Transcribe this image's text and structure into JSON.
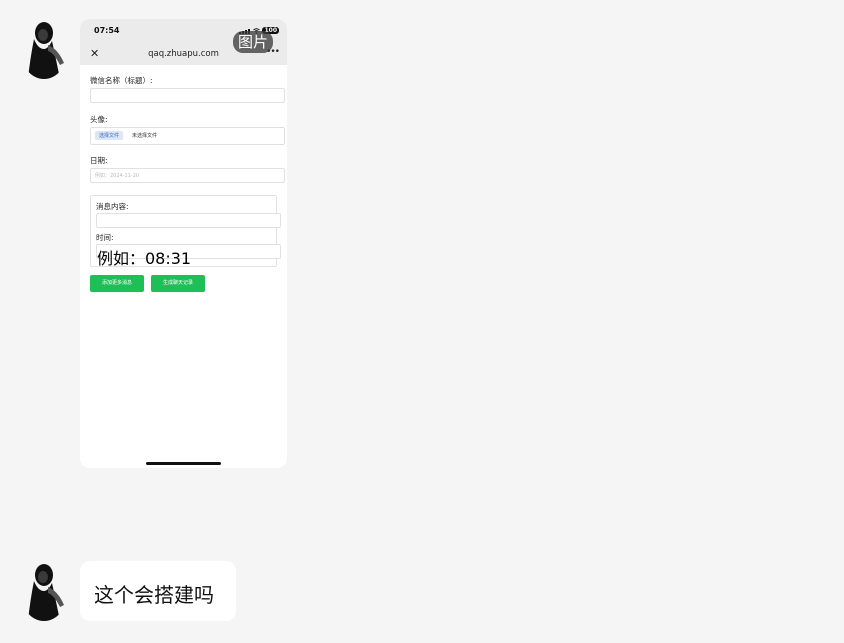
{
  "messages": [
    {
      "type": "image",
      "image_tag": "图片",
      "phone": {
        "status_time": "07:54",
        "battery": "100",
        "url": "qaq.zhuapu.com",
        "form": {
          "wechat_name_label": "微信名称（标题）:",
          "avatar_label": "头像:",
          "file_button": "选择文件",
          "file_status": "未选择文件",
          "date_label": "日期:",
          "date_placeholder": "例如：2024-11-20",
          "message_content_label": "消息内容:",
          "time_label": "时间:",
          "time_placeholder": "例如：08:31",
          "add_more_button": "添加更多消息",
          "generate_button": "生成聊天记录"
        }
      }
    },
    {
      "type": "text",
      "text": "这个会搭建吗"
    }
  ],
  "icons": {
    "close": "close-icon",
    "more": "more-icon",
    "signal": "signal-icon",
    "wifi": "wifi-icon",
    "battery": "battery-icon"
  },
  "colors": {
    "background": "#f5f5f5",
    "bubble": "#ffffff",
    "button_green": "#1fbf58",
    "file_button_bg": "#dce6f5"
  }
}
